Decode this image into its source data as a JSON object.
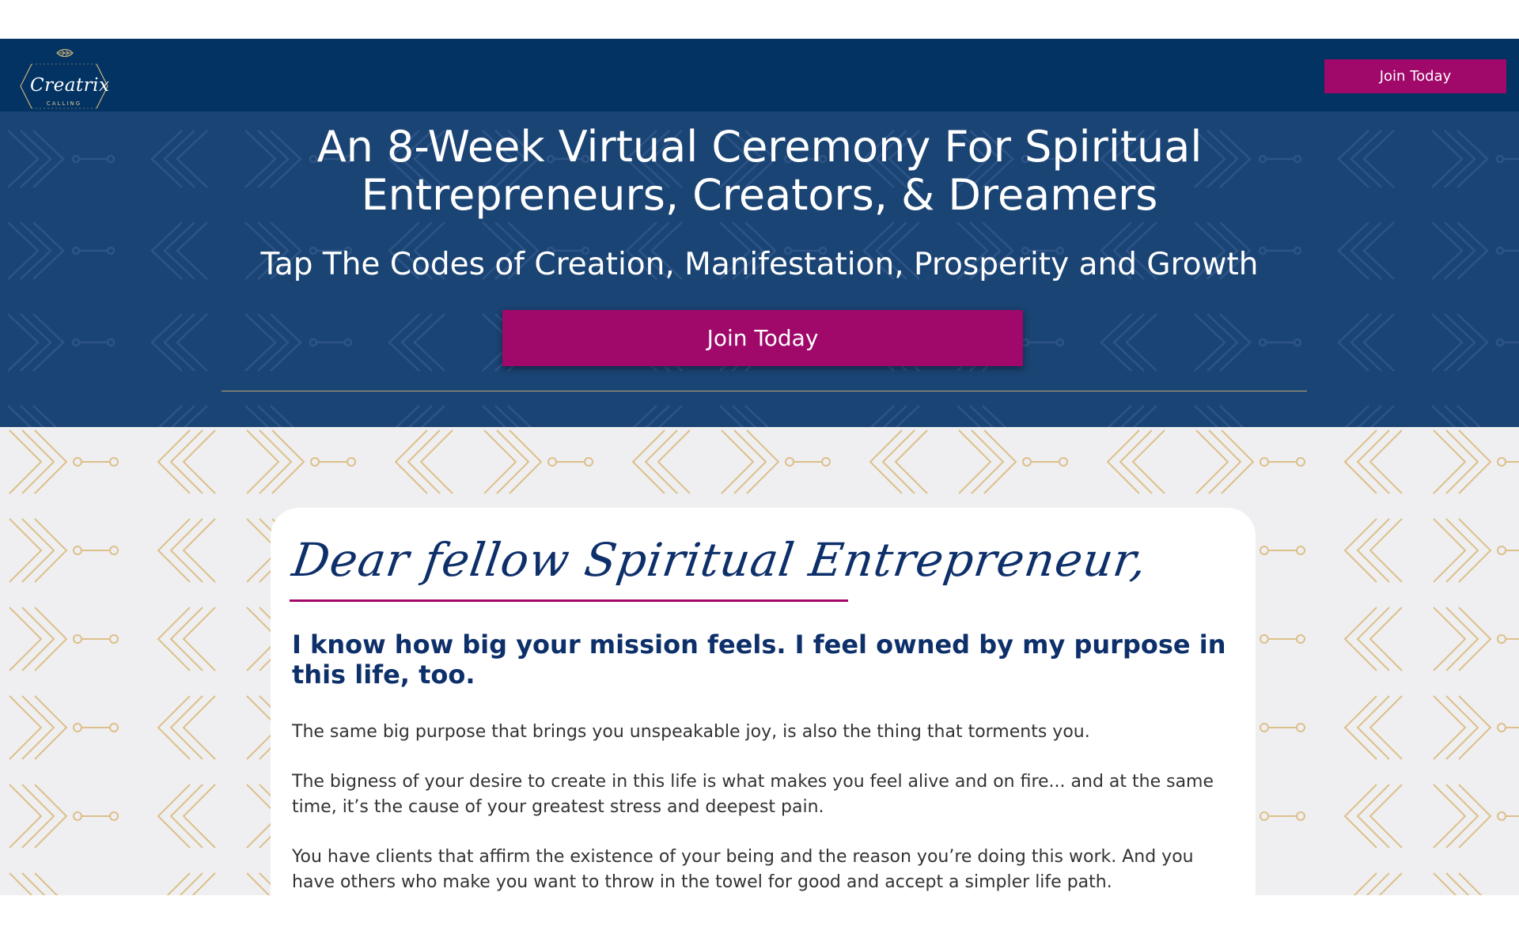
{
  "header": {
    "logo": {
      "script_text": "Creatrix",
      "sub_text": "CALLING"
    },
    "join_label": "Join Today"
  },
  "hero": {
    "title": "An 8-Week Virtual Ceremony For Spiritual Entrepreneurs, Creators, & Dreamers",
    "subtitle": "Tap The Codes of Creation, Manifestation, Prosperity and Growth",
    "join_label": "Join Today"
  },
  "letter": {
    "salutation": "Dear fellow Spiritual Entrepreneur,",
    "heading": "I know how big your mission feels. I feel owned by my purpose in this life, too.",
    "paragraphs": [
      "The same big purpose that brings you unspeakable joy, is also the thing that torments you.",
      "The bigness of your desire to create in this life is what makes you feel alive and on fire... and at the same time, it’s the cause of your greatest stress and deepest pain.",
      "You have clients that affirm the existence of your being and the reason you’re doing this work. And you have others who make you want to throw in the towel for good and accept a simpler life path."
    ]
  },
  "colors": {
    "navy_bar": "#033363",
    "hero_blue": "#1a4474",
    "accent_magenta": "#a0086a",
    "gold_pattern": "#d9b97a",
    "heading_navy": "#0d2f6a"
  },
  "icons": {
    "logo_mark": "feather-icon",
    "pattern": "arrow-chevron-pattern"
  }
}
